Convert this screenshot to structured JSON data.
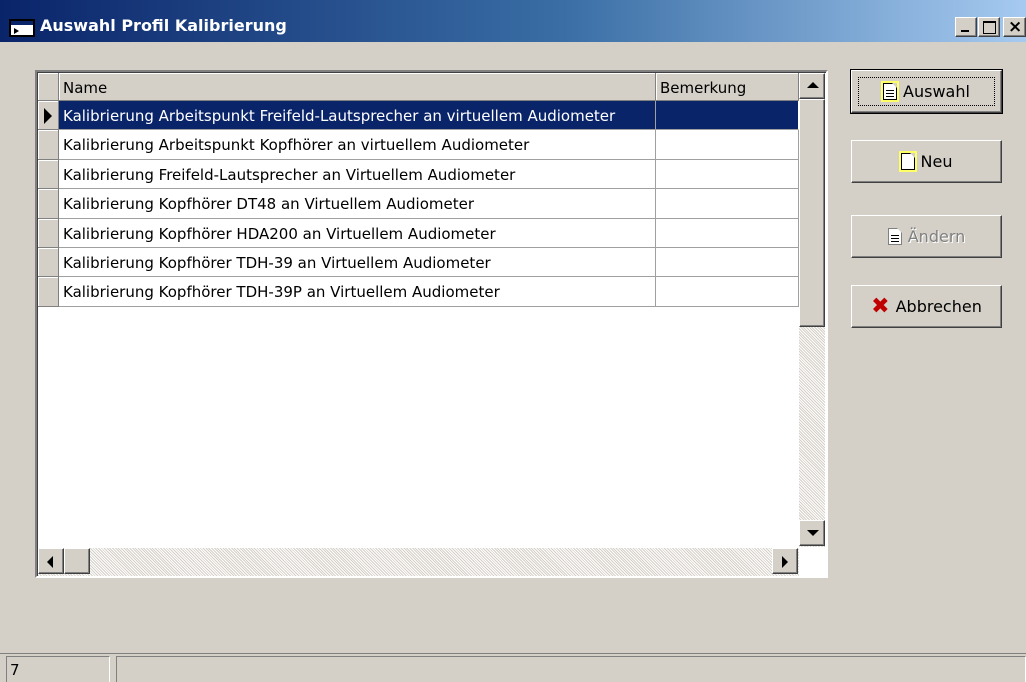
{
  "window": {
    "title": "Auswahl Profil Kalibrierung",
    "controls": [
      "minimize",
      "maximize",
      "close"
    ]
  },
  "grid": {
    "columns": [
      "Name",
      "Bemerkung"
    ],
    "rows": [
      {
        "name": "Kalibrierung Arbeitspunkt Freifeld-Lautsprecher an virtuellem Audiometer",
        "remark": "",
        "selected": true
      },
      {
        "name": "Kalibrierung Arbeitspunkt Kopfhörer an virtuellem Audiometer",
        "remark": ""
      },
      {
        "name": "Kalibrierung Freifeld-Lautsprecher an Virtuellem Audiometer",
        "remark": ""
      },
      {
        "name": "Kalibrierung Kopfhörer DT48 an Virtuellem Audiometer",
        "remark": ""
      },
      {
        "name": "Kalibrierung Kopfhörer HDA200 an Virtuellem Audiometer",
        "remark": ""
      },
      {
        "name": "Kalibrierung Kopfhörer TDH-39 an Virtuellem Audiometer",
        "remark": ""
      },
      {
        "name": "Kalibrierung Kopfhörer TDH-39P an Virtuellem Audiometer",
        "remark": ""
      }
    ]
  },
  "buttons": {
    "auswahl": {
      "label": "Auswahl",
      "icon": "document-lined-icon"
    },
    "neu": {
      "label": "Neu",
      "icon": "new-document-icon"
    },
    "aendern": {
      "label": "Ändern",
      "icon": "edit-document-icon",
      "disabled": true
    },
    "abbrechen": {
      "label": "Abbrechen",
      "icon": "red-x-icon"
    }
  },
  "status": {
    "record_count": "7",
    "message": ""
  },
  "colors": {
    "selection": "#0a246a",
    "face": "#d4d0c8",
    "cancel_icon": "#c00000"
  }
}
